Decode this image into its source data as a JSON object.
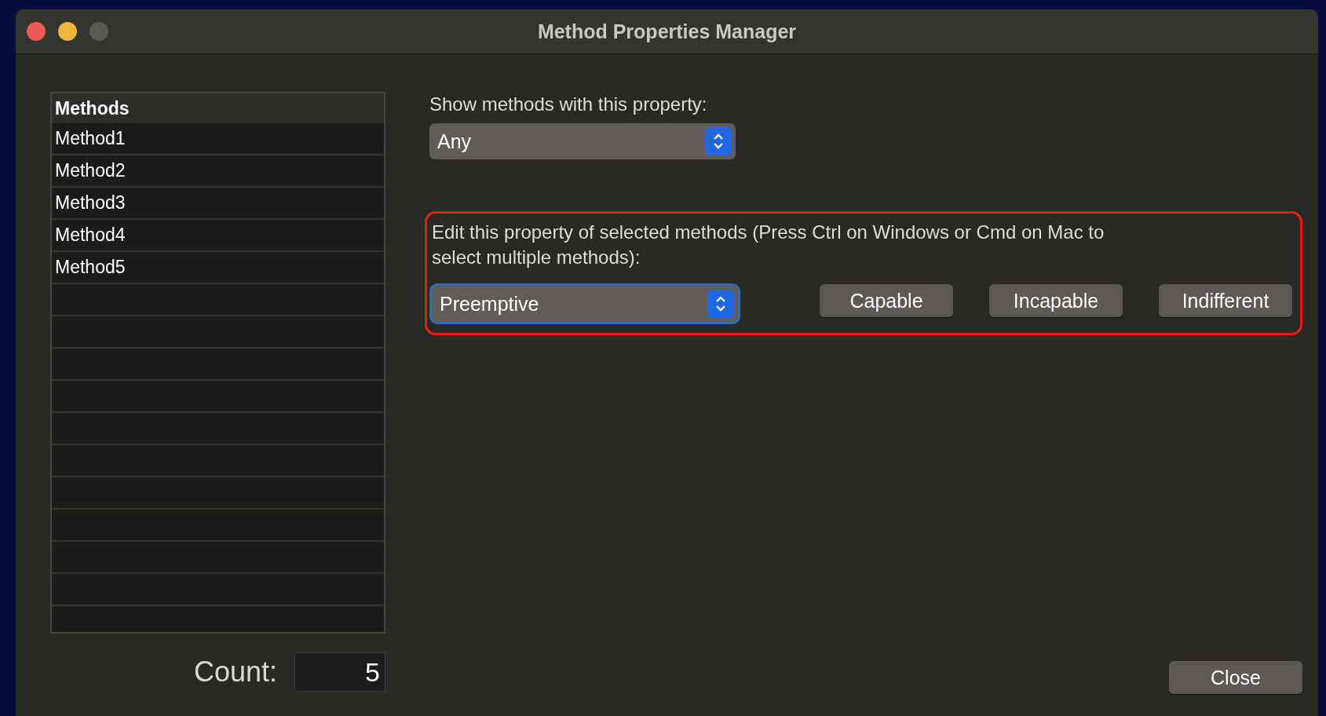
{
  "window": {
    "title": "Method Properties Manager"
  },
  "methods": {
    "header": "Methods",
    "items": [
      "Method1",
      "Method2",
      "Method3",
      "Method4",
      "Method5"
    ]
  },
  "filter": {
    "label": "Show methods with this property:",
    "value": "Any",
    "focused": false
  },
  "edit": {
    "label": "Edit this property of selected methods (Press Ctrl on Windows or Cmd on Mac to select multiple methods):",
    "value": "Preemptive",
    "focused": true,
    "highlighted": true,
    "buttons": [
      "Capable",
      "Incapable",
      "Indifferent"
    ]
  },
  "count": {
    "label": "Count:",
    "value": "5"
  },
  "close_button": "Close"
}
